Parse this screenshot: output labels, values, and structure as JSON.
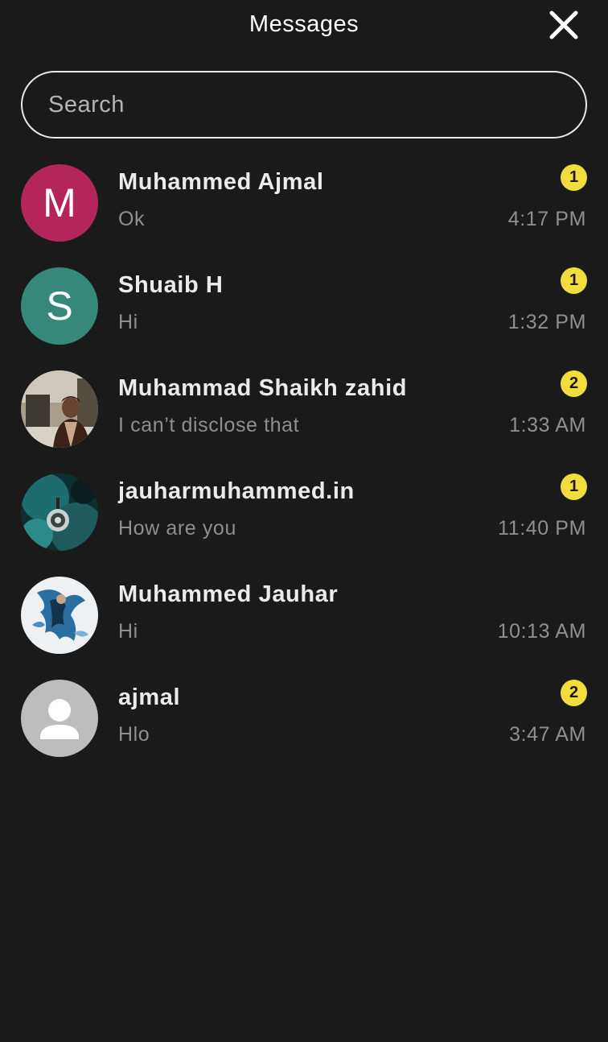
{
  "header": {
    "title": "Messages"
  },
  "search": {
    "placeholder": "Search",
    "value": ""
  },
  "colors": {
    "background": "#1b1a1a",
    "badge": "#f1dd3e",
    "muted_text": "#8e8e94"
  },
  "conversations": [
    {
      "name": "Muhammed Ajmal",
      "preview": "Ok",
      "time": "4:17 PM",
      "unread": "1",
      "avatar": {
        "type": "letter",
        "letter": "M",
        "color": "#b4265b"
      }
    },
    {
      "name": "Shuaib H",
      "preview": "Hi",
      "time": "1:32 PM",
      "unread": "1",
      "avatar": {
        "type": "letter",
        "letter": "S",
        "color": "#35887a"
      }
    },
    {
      "name": "Muhammad Shaikh zahid",
      "preview": "I can’t disclose that",
      "time": "1:33 AM",
      "unread": "2",
      "avatar": {
        "type": "photo",
        "icon": "person-photo"
      }
    },
    {
      "name": "jauharmuhammed.in",
      "preview": "How are you",
      "time": "11:40 PM",
      "unread": "1",
      "avatar": {
        "type": "photo",
        "icon": "abstract-photo"
      }
    },
    {
      "name": "Muhammed Jauhar",
      "preview": "Hi",
      "time": "10:13 AM",
      "unread": "",
      "avatar": {
        "type": "photo",
        "icon": "artwork-photo"
      }
    },
    {
      "name": "ajmal",
      "preview": "Hlo",
      "time": "3:47 AM",
      "unread": "2",
      "avatar": {
        "type": "placeholder",
        "icon": "default-user-icon"
      }
    }
  ]
}
